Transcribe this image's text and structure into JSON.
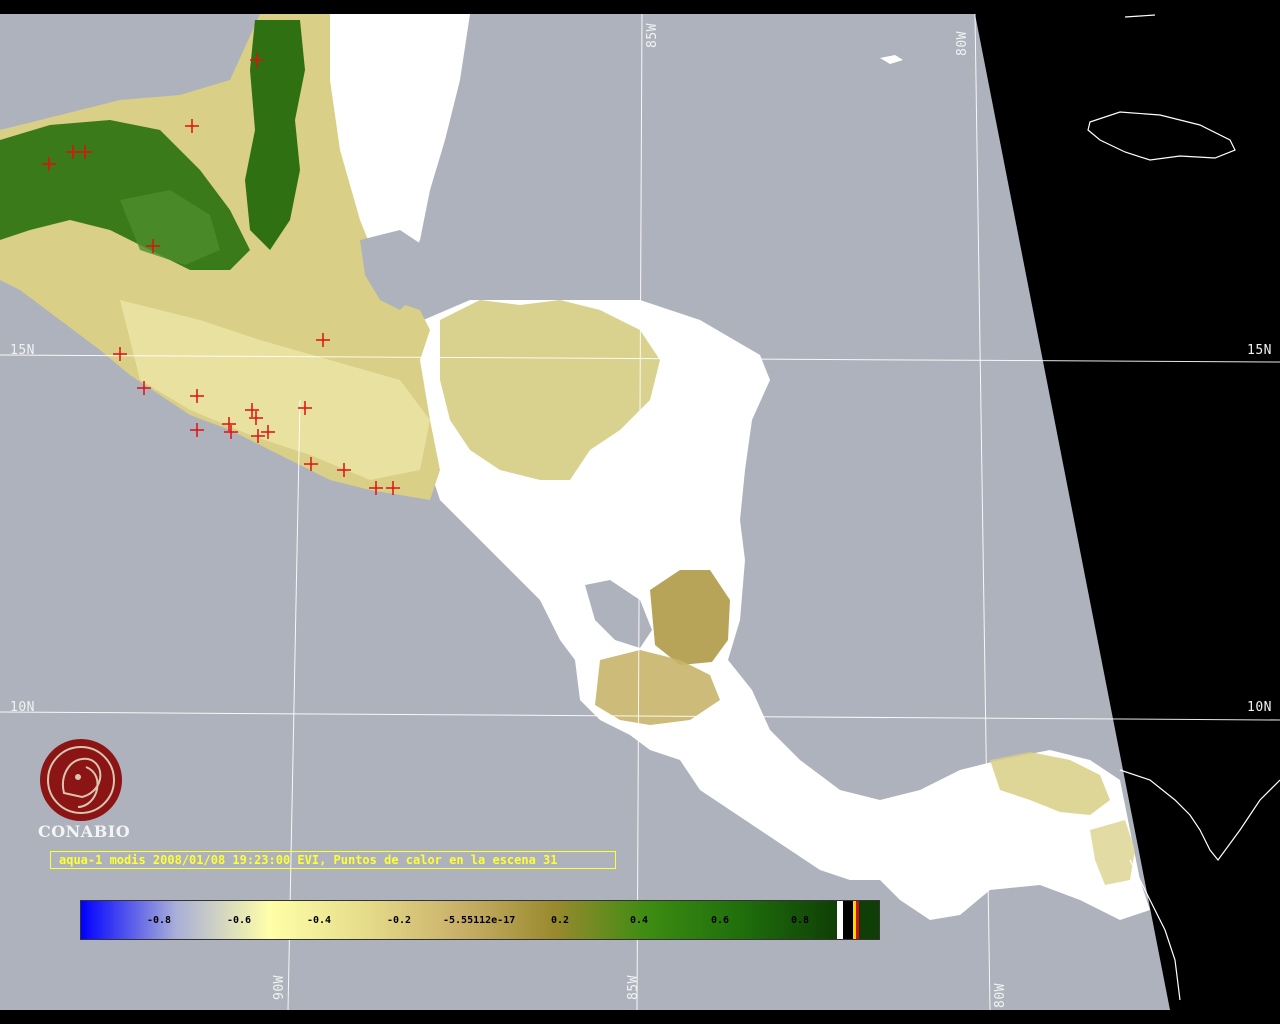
{
  "grid": {
    "lat_labels": [
      "15N",
      "10N"
    ],
    "lon_labels_top": [
      "85W",
      "80W"
    ],
    "lon_labels_bottom": [
      "90W",
      "85W",
      "80W"
    ]
  },
  "caption": "aqua-1 modis 2008/01/08 19:23:00 EVI, Puntos de calor en la escena 31",
  "legend": {
    "ticks": [
      "-0.8",
      "-0.6",
      "-0.4",
      "-0.2",
      "-5.55112e-17",
      "0.2",
      "0.4",
      "0.6",
      "0.8"
    ],
    "colors": [
      "#0000ff",
      "#a8aed8",
      "#ffffa8",
      "#e6dc8a",
      "#c9b16a",
      "#9a8a2e",
      "#3d8c12",
      "#1f6e0c",
      "#0f3f06"
    ]
  },
  "logo": {
    "name": "CONABIO"
  },
  "colors": {
    "background_sea": "#aeb2bc",
    "land_cloud": "#ffffff",
    "fire_marker": "#e01010",
    "grid_line": "#ffffff",
    "caption": "#ffff33"
  }
}
